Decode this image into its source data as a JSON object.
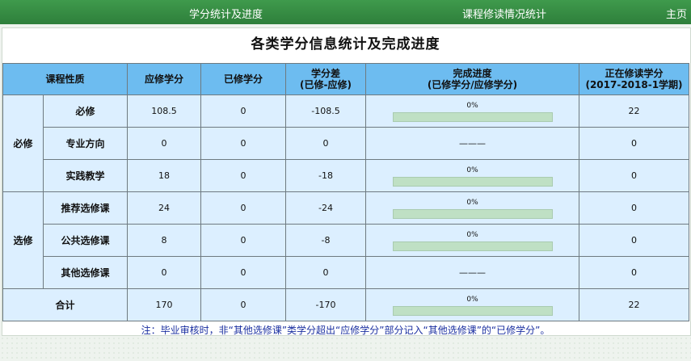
{
  "nav": {
    "left": "学分统计及进度",
    "middle": "课程修读情况统计",
    "right": "主页"
  },
  "title": "各类学分信息统计及完成进度",
  "headers": {
    "category": "课程性质",
    "required": "应修学分",
    "earned": "已修学分",
    "diff_line1": "学分差",
    "diff_line2": "(已修-应修)",
    "progress_line1": "完成进度",
    "progress_line2": "(已修学分/应修学分)",
    "current_line1": "正在修读学分",
    "current_line2": "(2017-2018-1学期)"
  },
  "groups": {
    "compulsory": "必修",
    "elective": "选修"
  },
  "rows": [
    {
      "name": "必修",
      "required": "108.5",
      "earned": "0",
      "diff": "-108.5",
      "progress_text": "0%",
      "progress": 0,
      "show_bar": true,
      "current": "22"
    },
    {
      "name": "专业方向",
      "required": "0",
      "earned": "0",
      "diff": "0",
      "progress_text": "———",
      "progress": 0,
      "show_bar": false,
      "current": "0"
    },
    {
      "name": "实践教学",
      "required": "18",
      "earned": "0",
      "diff": "-18",
      "progress_text": "0%",
      "progress": 0,
      "show_bar": true,
      "current": "0"
    },
    {
      "name": "推荐选修课",
      "required": "24",
      "earned": "0",
      "diff": "-24",
      "progress_text": "0%",
      "progress": 0,
      "show_bar": true,
      "current": "0"
    },
    {
      "name": "公共选修课",
      "required": "8",
      "earned": "0",
      "diff": "-8",
      "progress_text": "0%",
      "progress": 0,
      "show_bar": true,
      "current": "0"
    },
    {
      "name": "其他选修课",
      "required": "0",
      "earned": "0",
      "diff": "0",
      "progress_text": "———",
      "progress": 0,
      "show_bar": false,
      "current": "0"
    }
  ],
  "total": {
    "name": "合计",
    "required": "170",
    "earned": "0",
    "diff": "-170",
    "progress_text": "0%",
    "progress": 0,
    "current": "22"
  },
  "note": "注：毕业审核时，非“其他选修课”类学分超出“应修学分”部分记入“其他选修课”的“已修学分”。"
}
